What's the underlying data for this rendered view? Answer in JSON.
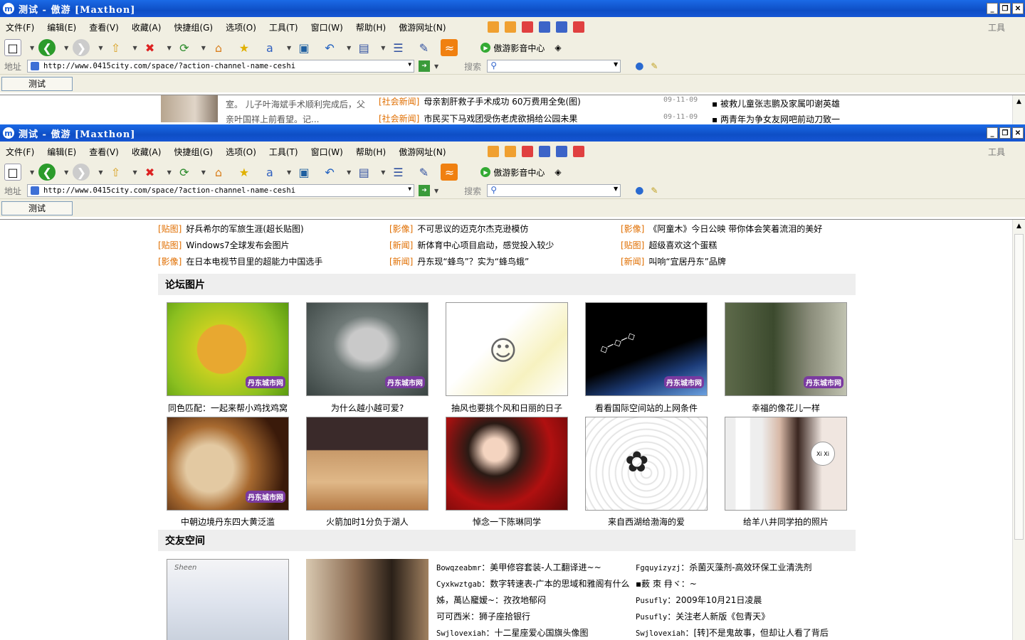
{
  "window": {
    "title": "测试 - 傲游 [Maxthon]",
    "logo": "m",
    "btn_min": "_",
    "btn_restore": "❐",
    "btn_close": "✕"
  },
  "menu": [
    "文件(F)",
    "编辑(E)",
    "查看(V)",
    "收藏(A)",
    "快捷组(G)",
    "选项(O)",
    "工具(T)",
    "窗口(W)",
    "帮助(H)",
    "傲游网址(N)"
  ],
  "menu_right": "工具",
  "toolbar": {
    "media_label": "傲游影音中心",
    "icons": [
      "new-page-icon",
      "back-icon",
      "forward-icon",
      "up-icon",
      "stop-icon",
      "refresh-icon",
      "home-icon",
      "favorites-star-icon",
      "translate-icon",
      "screen-icon",
      "undo-icon",
      "columns-icon",
      "list-icon",
      "edit-icon",
      "rss-icon"
    ]
  },
  "address": {
    "label": "地址",
    "url": "http://www.0415city.com/space/?action-channel-name-ceshi",
    "search_label": "搜索",
    "search_value": ""
  },
  "tab": {
    "label": "测试"
  },
  "top_snippet": {
    "desc_line1": "室。 儿子叶海斌手术顺利完成后，父",
    "desc_line2": "亲叶国祥上前看望。记...",
    "news": [
      {
        "cat": "[社会新闻]",
        "title": "母亲割肝救子手术成功 60万费用全免(图)",
        "date": "09-11-09"
      },
      {
        "cat": "[社会新闻]",
        "title": "市民买下马戏团受伤老虎欲捐给公园未果",
        "date": "09-11-09"
      }
    ],
    "side": [
      "被救儿童张志鹏及家属叩谢英雄",
      "两青年为争女友网吧前动刀致一"
    ]
  },
  "news_grid": [
    [
      {
        "cat": "[贴图]",
        "title": "好兵希尔的军旅生涯(超长贴图)"
      },
      {
        "cat": "[影像]",
        "title": "不可思议的迈克尔杰克逊模仿"
      },
      {
        "cat": "[影像]",
        "title": "《阿童木》今日公映 带你体会笑着流泪的美好"
      }
    ],
    [
      {
        "cat": "[贴图]",
        "title": "Windows7全球发布会图片"
      },
      {
        "cat": "[新闻]",
        "title": "新体育中心项目启动，感觉投入较少"
      },
      {
        "cat": "[贴图]",
        "title": "超级喜欢这个蛋糕"
      }
    ],
    [
      {
        "cat": "[影像]",
        "title": "在日本电视节目里的超能力中国选手"
      },
      {
        "cat": "[新闻]",
        "title": "丹东现“蜂鸟”？实为“蜂鸟蛾”"
      },
      {
        "cat": "[新闻]",
        "title": "叫响“宜居丹东”品牌"
      }
    ]
  ],
  "forum_title": "论坛图片",
  "forum_row1": [
    "同色匹配：一起来帮小鸡找鸡窝",
    "为什么越小越可爱?",
    "抽风也要挑个风和日丽的日子",
    "看看国际空间站的上网条件",
    "幸福的像花儿一样"
  ],
  "forum_row2": [
    "中朝边境丹东四大黄泛滥",
    "火箭加时1分负于湖人",
    "悼念一下陈琳同学",
    "来自西湖给渤海的爱",
    "给羊八井同学拍的照片"
  ],
  "watermark": "丹东城市网",
  "space_title": "交友空间",
  "friends_left": [
    {
      "user": "Bowqzeabmr",
      "text": "：美甲修容套装-人工翻译进~~"
    },
    {
      "user": "Cyxkwztgab",
      "text": "：数字转速表-广本的思域和雅阁有什么"
    },
    {
      "user": "",
      "text": "姊，萬亾竉嫒~：孜孜地郁闷"
    },
    {
      "user": "",
      "text": "可可西米：狮子座拾银行"
    },
    {
      "user": "Swjlovexiah",
      "text": "：十二星座爱心国旗头像图"
    }
  ],
  "friends_right": [
    {
      "user": "Fgquyizyzj",
      "text": "：杀菌灭藻剂-高效环保工业清洗剂"
    },
    {
      "user": "",
      "text": "▪薮 朿 冄ヾ：~"
    },
    {
      "user": "Pusufly",
      "text": "：2009年10月21日凌晨"
    },
    {
      "user": "Pusufly",
      "text": "：关注老人新版《包青天》"
    },
    {
      "user": "Swjlovexiah",
      "text": "：[转]不是鬼故事，但却让人看了背后"
    }
  ],
  "photo_caption": "Sheen",
  "colors": {
    "titlebar": "#0e4ec5",
    "chrome": "#f1efe2",
    "category": "#e06e00",
    "section_bg": "#eeeeee"
  }
}
